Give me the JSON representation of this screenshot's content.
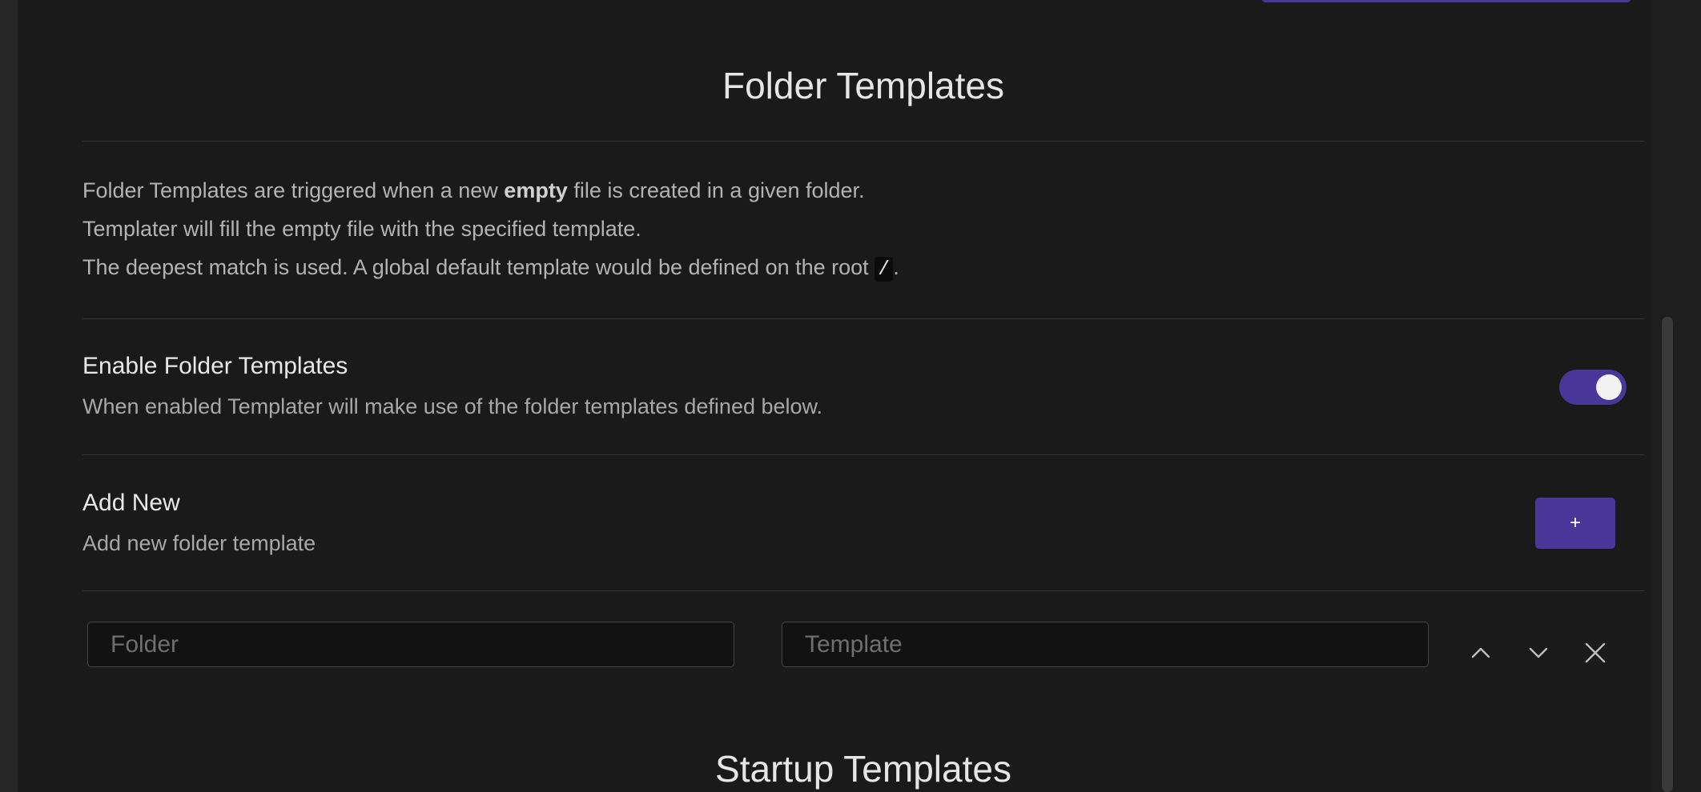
{
  "folder_templates": {
    "title": "Folder Templates",
    "description": {
      "line1_before": "Folder Templates are triggered when a new ",
      "line1_bold": "empty",
      "line1_after": " file is created in a given folder.",
      "line2": "Templater will fill the empty file with the specified template.",
      "line3_before": "The deepest match is used. A global default template would be defined on the root ",
      "line3_code": "/",
      "line3_after": "."
    },
    "enable": {
      "name": "Enable Folder Templates",
      "desc": "When enabled Templater will make use of the folder templates defined below.",
      "enabled": true
    },
    "add_new": {
      "name": "Add New",
      "desc": "Add new folder template",
      "button_label": "+"
    },
    "row": {
      "folder_placeholder": "Folder",
      "template_placeholder": "Template",
      "icons": [
        "chevron-up-icon",
        "chevron-down-icon",
        "close-icon"
      ]
    }
  },
  "startup_templates": {
    "title": "Startup Templates"
  },
  "colors": {
    "accent": "#483699",
    "background": "#1a1a1a"
  }
}
